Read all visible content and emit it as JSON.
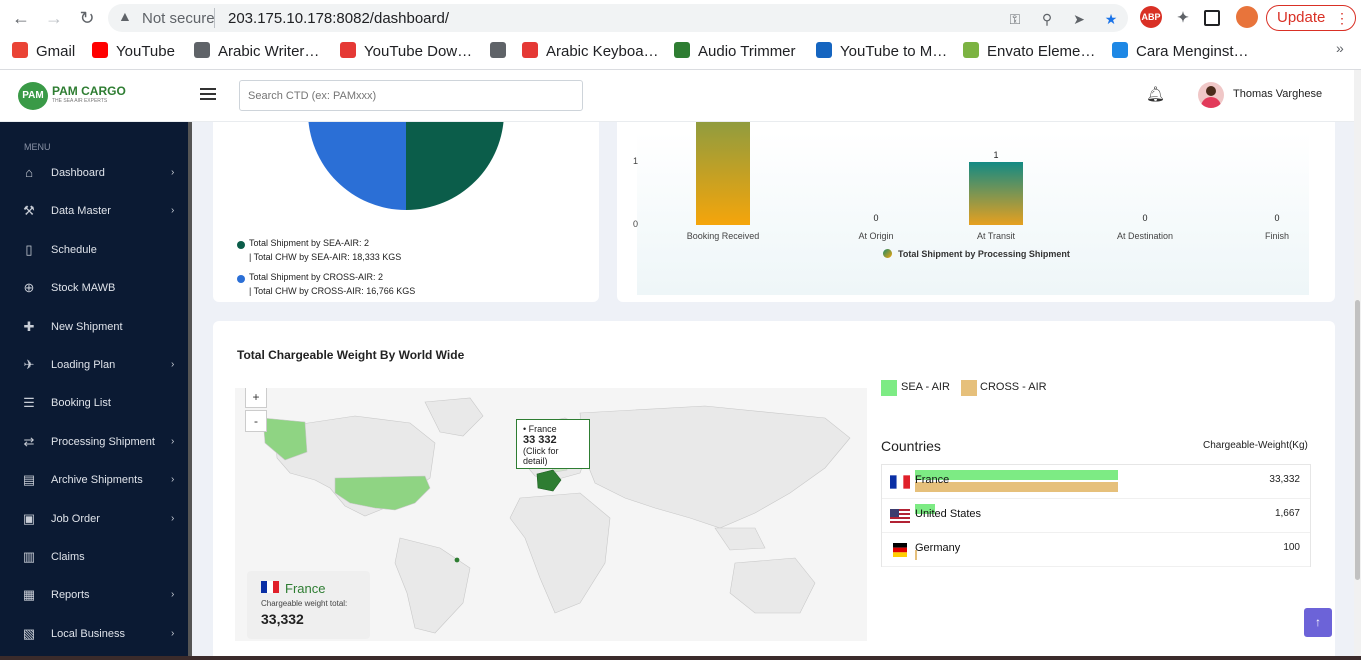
{
  "browser": {
    "not_secure": "Not secure",
    "url": "203.175.10.178:8082/dashboard/",
    "update_label": "Update",
    "bookmarks": [
      {
        "label": "Gmail",
        "icon": "gmail-icon",
        "color": "#ea4335"
      },
      {
        "label": "YouTube",
        "icon": "youtube-icon",
        "color": "#ff0000"
      },
      {
        "label": "Arabic Writer…",
        "icon": "globe-icon",
        "color": "#5f6368"
      },
      {
        "label": "YouTube Dow…",
        "icon": "download-icon",
        "color": "#e53935"
      },
      {
        "label": "",
        "icon": "globe-icon",
        "color": "#5f6368"
      },
      {
        "label": "Arabic Keyboa…",
        "icon": "keyboard-icon",
        "color": "#e53935"
      },
      {
        "label": "Audio Trimmer",
        "icon": "scissors-icon",
        "color": "#2e7d32"
      },
      {
        "label": "YouTube to M…",
        "icon": "cloud-download-icon",
        "color": "#1565c0"
      },
      {
        "label": "Envato Eleme…",
        "icon": "leaf-icon",
        "color": "#7cb342"
      },
      {
        "label": "Cara Menginst…",
        "icon": "refresh-icon",
        "color": "#1e88e5"
      }
    ]
  },
  "header": {
    "logo_text": "PAM CARGO",
    "logo_tag": "THE SEA AIR EXPERTS",
    "logo_badge": "PAM",
    "search_placeholder": "Search CTD (ex: PAMxxx)",
    "user_name": "Thomas Varghese"
  },
  "sidebar": {
    "menu_header": "MENU",
    "items": [
      {
        "label": "Dashboard",
        "icon": "home-icon",
        "chevron": true
      },
      {
        "label": "Data Master",
        "icon": "tools-icon",
        "chevron": true
      },
      {
        "label": "Schedule",
        "icon": "book-icon",
        "chevron": false
      },
      {
        "label": "Stock MAWB",
        "icon": "plus-circle-icon",
        "chevron": false
      },
      {
        "label": "New Shipment",
        "icon": "plus-icon",
        "chevron": false
      },
      {
        "label": "Loading Plan",
        "icon": "plane-icon",
        "chevron": true
      },
      {
        "label": "Booking List",
        "icon": "list-icon",
        "chevron": false
      },
      {
        "label": "Processing Shipment",
        "icon": "sync-icon",
        "chevron": true
      },
      {
        "label": "Archive Shipments",
        "icon": "archive-icon",
        "chevron": true
      },
      {
        "label": "Job Order",
        "icon": "briefcase-icon",
        "chevron": true
      },
      {
        "label": "Claims",
        "icon": "money-icon",
        "chevron": false
      },
      {
        "label": "Reports",
        "icon": "report-icon",
        "chevron": true
      },
      {
        "label": "Local Business",
        "icon": "building-icon",
        "chevron": true
      }
    ]
  },
  "pie": {
    "legend": [
      {
        "line1": "Total Shipment by SEA-AIR: 2",
        "line2": "| Total CHW by SEA-AIR: 18,333 KGS",
        "color": "#0b5d4a"
      },
      {
        "line1": "Total Shipment by CROSS-AIR: 2",
        "line2": "| Total CHW by CROSS-AIR: 16,766 KGS",
        "color": "#2b6fd6"
      }
    ]
  },
  "chart_data": {
    "type": "bar",
    "categories": [
      "Booking Received",
      "At Origin",
      "At Transit",
      "At Destination",
      "Finish"
    ],
    "series": [
      {
        "name": "Total Shipment by Processing Shipment",
        "values": [
          2,
          0,
          1,
          0,
          0
        ]
      }
    ],
    "yticks": [
      "0",
      "1"
    ],
    "ylim": [
      0,
      2
    ],
    "legend_position": "bottom"
  },
  "map": {
    "title": "Total Chargeable Weight By World Wide",
    "zoom_in": "+",
    "zoom_out": "-",
    "tooltip": {
      "country": "• France",
      "value": "33 332",
      "hint": "(Click for detail)"
    },
    "selected": {
      "country": "France",
      "label": "Chargeable weight total:",
      "value": "33,332"
    },
    "legend": [
      {
        "label": "SEA - AIR",
        "color": "#7deb84"
      },
      {
        "label": "CROSS - AIR",
        "color": "#e6c07b"
      }
    ],
    "countries_header": "Countries",
    "weight_header": "Chargeable-Weight(Kg)",
    "countries": [
      {
        "name": "France",
        "value": "33,332",
        "sea": 33332,
        "cross": 33332
      },
      {
        "name": "United States",
        "value": "1,667",
        "sea": 1667,
        "cross": 0
      },
      {
        "name": "Germany",
        "value": "100",
        "sea": 0,
        "cross": 100
      }
    ]
  }
}
